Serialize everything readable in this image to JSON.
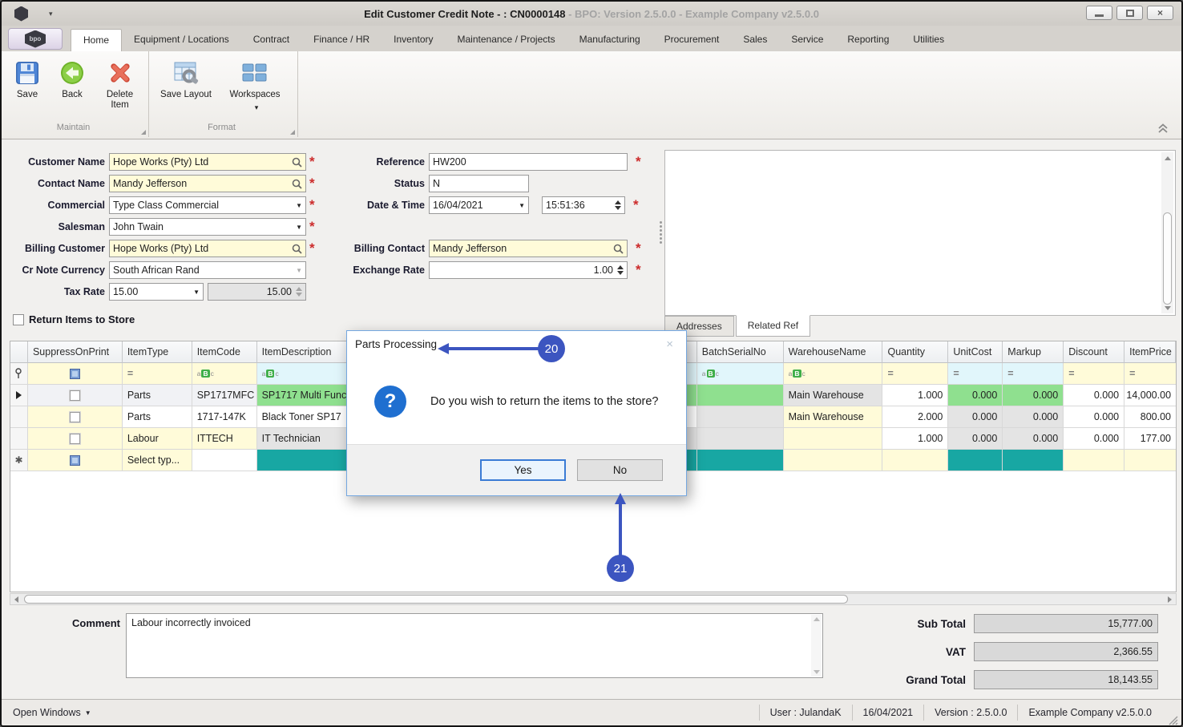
{
  "window": {
    "title": "Edit Customer Credit Note - : CN0000148",
    "title_suffix": " - BPO: Version 2.5.0.0 - Example Company v2.5.0.0",
    "app_logo": "bpo"
  },
  "ribbon": {
    "tabs": [
      "Home",
      "Equipment / Locations",
      "Contract",
      "Finance / HR",
      "Inventory",
      "Maintenance / Projects",
      "Manufacturing",
      "Procurement",
      "Sales",
      "Service",
      "Reporting",
      "Utilities"
    ],
    "active_tab": "Home",
    "toolbar": {
      "save": "Save",
      "back": "Back",
      "delete_item": "Delete Item",
      "save_layout": "Save Layout",
      "workspaces": "Workspaces"
    },
    "groups": {
      "maintain": "Maintain",
      "format": "Format"
    }
  },
  "form": {
    "customer_name": {
      "label": "Customer Name",
      "value": "Hope Works (Pty) Ltd"
    },
    "contact_name": {
      "label": "Contact Name",
      "value": "Mandy Jefferson"
    },
    "commercial": {
      "label": "Commercial",
      "value": "Type Class Commercial"
    },
    "salesman": {
      "label": "Salesman",
      "value": "John Twain"
    },
    "billing_customer": {
      "label": "Billing Customer",
      "value": "Hope Works (Pty) Ltd"
    },
    "cr_note_currency": {
      "label": "Cr Note Currency",
      "value": "South African Rand"
    },
    "tax_rate": {
      "label": "Tax Rate",
      "value": "15.00",
      "value2": "15.00"
    },
    "reference": {
      "label": "Reference",
      "value": "HW200"
    },
    "status": {
      "label": "Status",
      "value": "N"
    },
    "date_time": {
      "label": "Date & Time",
      "date": "16/04/2021",
      "time": "15:51:36"
    },
    "billing_contact": {
      "label": "Billing Contact",
      "value": "Mandy Jefferson"
    },
    "exchange_rate": {
      "label": "Exchange Rate",
      "value": "1.00"
    },
    "return_items": {
      "label": "Return Items to Store"
    }
  },
  "right_panel": {
    "tabs": [
      "Addresses",
      "Related Ref"
    ],
    "active_tab": "Related Ref"
  },
  "grid": {
    "columns": [
      "SuppressOnPrint",
      "ItemType",
      "ItemCode",
      "ItemDescription",
      "BatchSerialNo",
      "WarehouseName",
      "Quantity",
      "UnitCost",
      "Markup",
      "Discount",
      "ItemPrice"
    ],
    "filter_icons": {
      "eq": "=",
      "a": "a",
      "b": "B",
      "c": "c"
    },
    "rows": [
      {
        "item_type": "Parts",
        "item_code": "SP1717MFC",
        "item_description": "SP1717 Multi Func",
        "batch_serial_no": "",
        "warehouse_name": "Main Warehouse",
        "quantity": "1.000",
        "unit_cost": "0.000",
        "markup": "0.000",
        "discount": "0.000",
        "item_price": "14,000.00"
      },
      {
        "item_type": "Parts",
        "item_code": "1717-147K",
        "item_description": "Black Toner SP17",
        "batch_serial_no": "",
        "warehouse_name": "Main Warehouse",
        "quantity": "2.000",
        "unit_cost": "0.000",
        "markup": "0.000",
        "discount": "0.000",
        "item_price": "800.00"
      },
      {
        "item_type": "Labour",
        "item_code": "ITTECH",
        "item_description": "IT Technician",
        "batch_serial_no": "",
        "warehouse_name": "",
        "quantity": "1.000",
        "unit_cost": "0.000",
        "markup": "0.000",
        "discount": "0.000",
        "item_price": "177.00"
      },
      {
        "item_type": "Select typ...",
        "item_code": "",
        "item_description": "",
        "batch_serial_no": "",
        "warehouse_name": "",
        "quantity": "",
        "unit_cost": "",
        "markup": "",
        "discount": "",
        "item_price": ""
      }
    ]
  },
  "dialog": {
    "title": "Parts Processing",
    "message": "Do you wish to return the items to the store?",
    "yes_label": "Yes",
    "no_label": "No"
  },
  "annotations": {
    "step_20": "20",
    "step_21": "21"
  },
  "comment": {
    "label": "Comment",
    "value": "Labour incorrectly invoiced"
  },
  "totals": {
    "sub_total": {
      "label": "Sub Total",
      "value": "15,777.00"
    },
    "vat": {
      "label": "VAT",
      "value": "2,366.55"
    },
    "grand_total": {
      "label": "Grand Total",
      "value": "18,143.55"
    }
  },
  "status_bar": {
    "open_windows": "Open Windows",
    "user": "User : JulandaK",
    "date": "16/04/2021",
    "version": "Version : 2.5.0.0",
    "company": "Example Company v2.5.0.0"
  },
  "colors": {
    "annotation_blue": "#3c55c0",
    "cell_green": "#8fe08f",
    "cell_teal": "#18a7a3",
    "cell_yellow": "#fffbd9",
    "filter_cyan": "#e1f6fb",
    "dialog_icon_blue": "#1f6fd0",
    "required_red": "#cc2b2b"
  }
}
